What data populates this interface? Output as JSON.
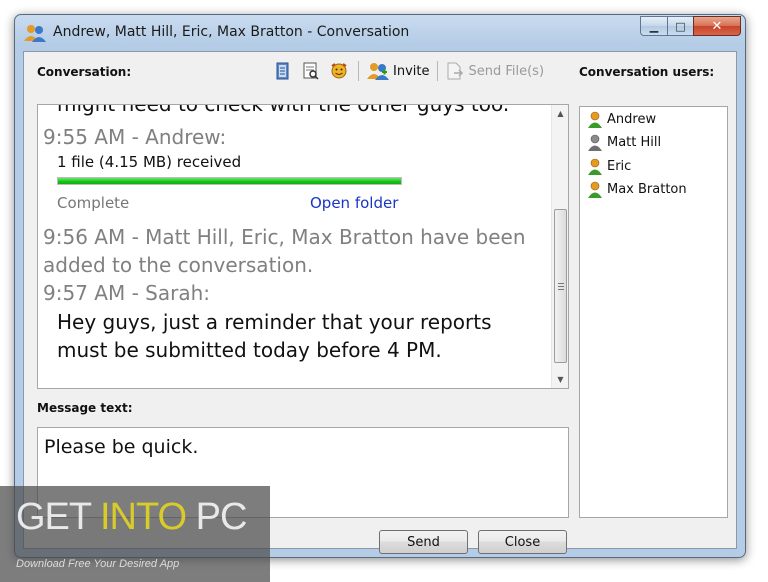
{
  "window": {
    "title": "Andrew, Matt Hill, Eric, Max Bratton - Conversation",
    "controls": {
      "minimize": "▁",
      "maximize": "□",
      "close": "✕"
    }
  },
  "conversation": {
    "label": "Conversation:",
    "toolbar": {
      "icons": [
        "history-icon",
        "preview-icon",
        "emoticon-icon"
      ],
      "invite_label": "Invite",
      "send_files_label": "Send File(s)"
    },
    "partial_line": "might need to check with the other guys too.",
    "messages": [
      {
        "header": "9:55 AM - Andrew:"
      },
      {
        "header": "9:56 AM - Matt Hill, Eric, Max Bratton have been",
        "header2": "added to the conversation."
      },
      {
        "header": "9:57 AM - Sarah:",
        "text1": "Hey guys, just a reminder that your reports",
        "text2": "must be submitted today before 4 PM."
      }
    ],
    "file_transfer": {
      "text": "1 file (4.15 MB) received",
      "progress_percent": 100,
      "status": "Complete",
      "open_folder_label": "Open folder"
    }
  },
  "message_text": {
    "label": "Message text:",
    "value": "Please be quick."
  },
  "users": {
    "label": "Conversation users:",
    "items": [
      {
        "name": "Andrew",
        "status": "online",
        "color": "#e69a1f"
      },
      {
        "name": "Matt Hill",
        "status": "offline",
        "color": "#8b8b8b"
      },
      {
        "name": "Eric",
        "status": "online",
        "color": "#e69a1f"
      },
      {
        "name": "Max Bratton",
        "status": "online",
        "color": "#e69a1f"
      }
    ]
  },
  "buttons": {
    "send": "Send",
    "close": "Close"
  },
  "watermark": {
    "part1": "GET ",
    "part2": "INTO",
    "part3": " PC",
    "tagline": "Download Free Your Desired App"
  },
  "colors": {
    "accent_green": "#11c411",
    "link_blue": "#1a35c4",
    "header_gray": "#808080"
  }
}
